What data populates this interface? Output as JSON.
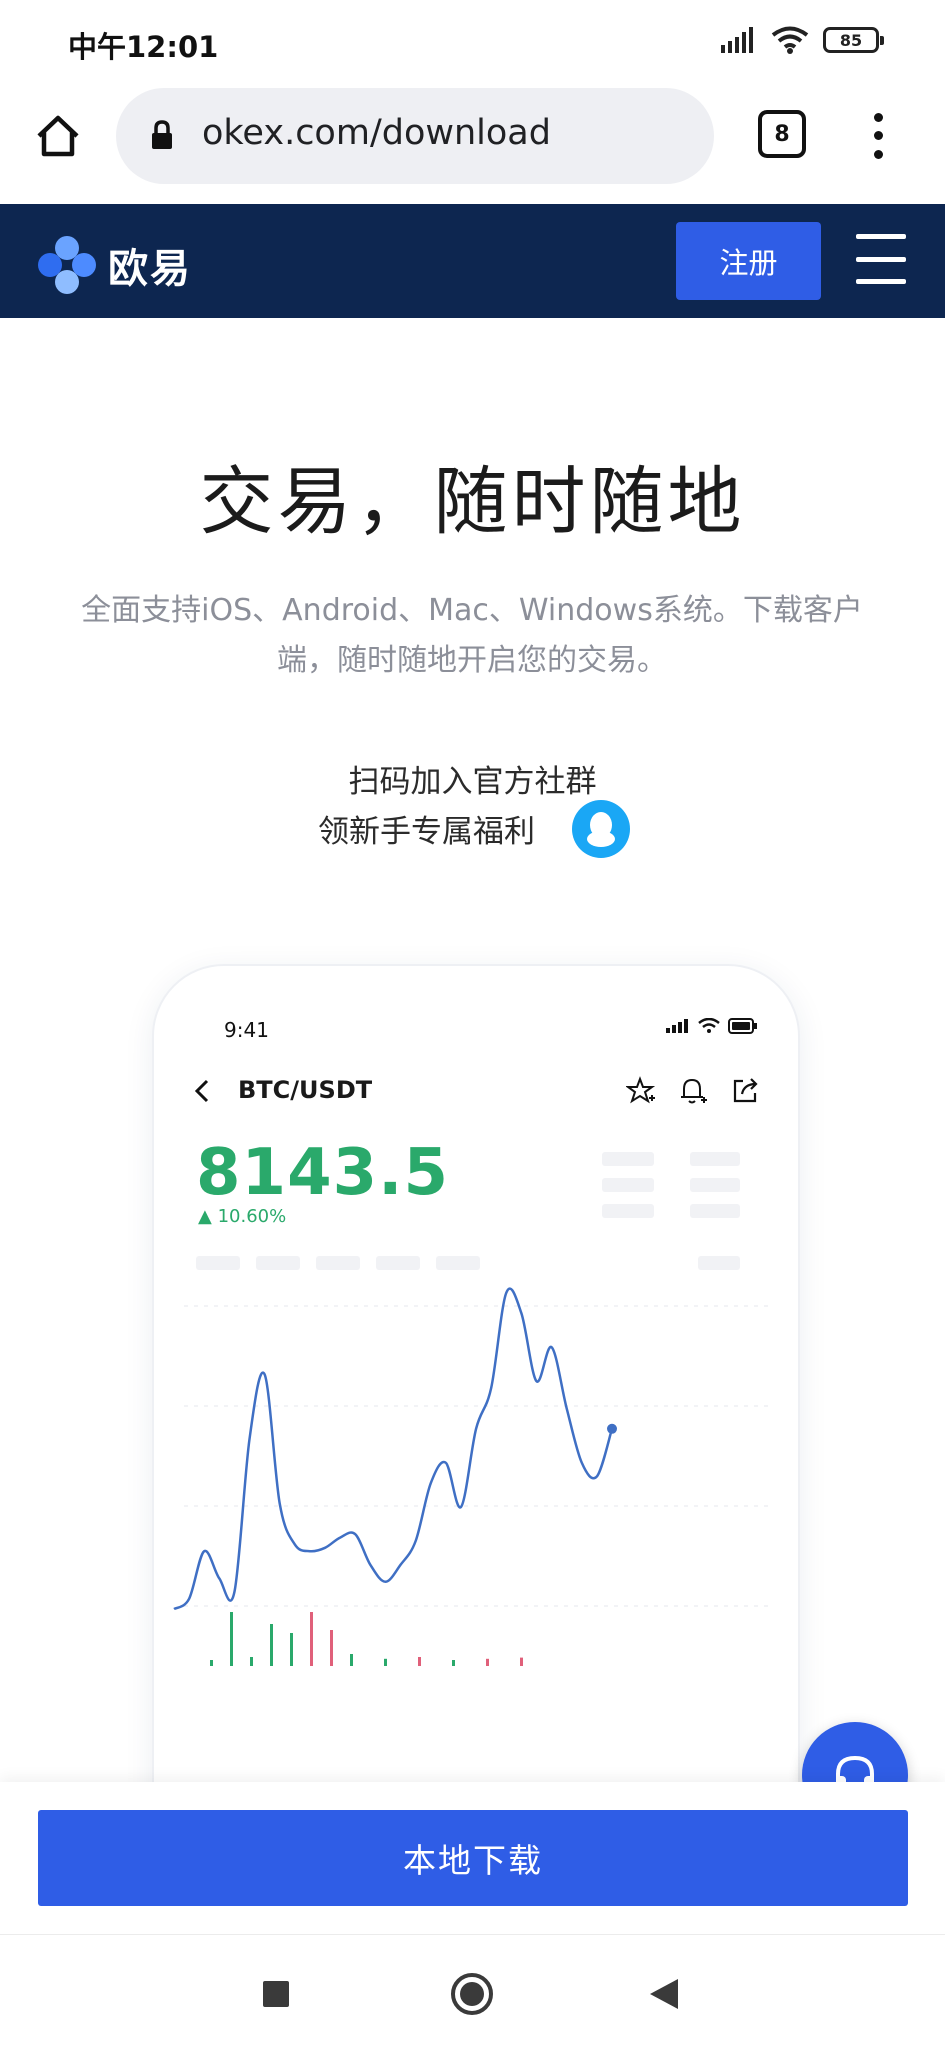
{
  "status_bar": {
    "time": "中午12:01",
    "battery": "85"
  },
  "browser": {
    "url": "okex.com/download",
    "tab_count": "8"
  },
  "site_nav": {
    "logo_text": "欧易",
    "register_label": "注册"
  },
  "hero": {
    "title": "交易，随时随地",
    "subtitle": "全面支持iOS、Android、Mac、Windows系统。下载客户端，随时随地开启您的交易。",
    "community_line1": "扫码加入官方社群",
    "community_line2": "领新手专属福利"
  },
  "phone_mock": {
    "time": "9:41",
    "pair": "BTC/USDT",
    "price": "8143.5",
    "change": "▲ 10.60%",
    "price_color": "#2aa96b",
    "line_color": "#3f6fc4"
  },
  "chart_data": {
    "type": "line",
    "title": "",
    "xlabel": "",
    "ylabel": "",
    "series": [
      {
        "values": [
          0.05,
          0.08,
          0.22,
          0.14,
          0.1,
          0.55,
          0.74,
          0.36,
          0.24,
          0.22,
          0.23,
          0.26,
          0.27,
          0.18,
          0.13,
          0.18,
          0.25,
          0.42,
          0.48,
          0.35,
          0.58,
          0.7,
          0.98,
          0.92,
          0.72,
          0.82,
          0.64,
          0.48,
          0.44,
          0.58
        ]
      }
    ],
    "volume_bars": [
      {
        "v": 0.1,
        "c": "up"
      },
      {
        "v": 0.9,
        "c": "up"
      },
      {
        "v": 0.15,
        "c": "up"
      },
      {
        "v": 0.7,
        "c": "up"
      },
      {
        "v": 0.55,
        "c": "up"
      },
      {
        "v": 0.9,
        "c": "down"
      },
      {
        "v": 0.6,
        "c": "down"
      },
      {
        "v": 0.2,
        "c": "up"
      },
      {
        "v": 0.12,
        "c": "up"
      },
      {
        "v": 0.15,
        "c": "down"
      },
      {
        "v": 0.1,
        "c": "up"
      },
      {
        "v": 0.12,
        "c": "down"
      },
      {
        "v": 0.14,
        "c": "down"
      }
    ]
  },
  "footer": {
    "download_label": "本地下载"
  },
  "colors": {
    "nav_bg": "#0d2650",
    "accent": "#2f5de6"
  }
}
